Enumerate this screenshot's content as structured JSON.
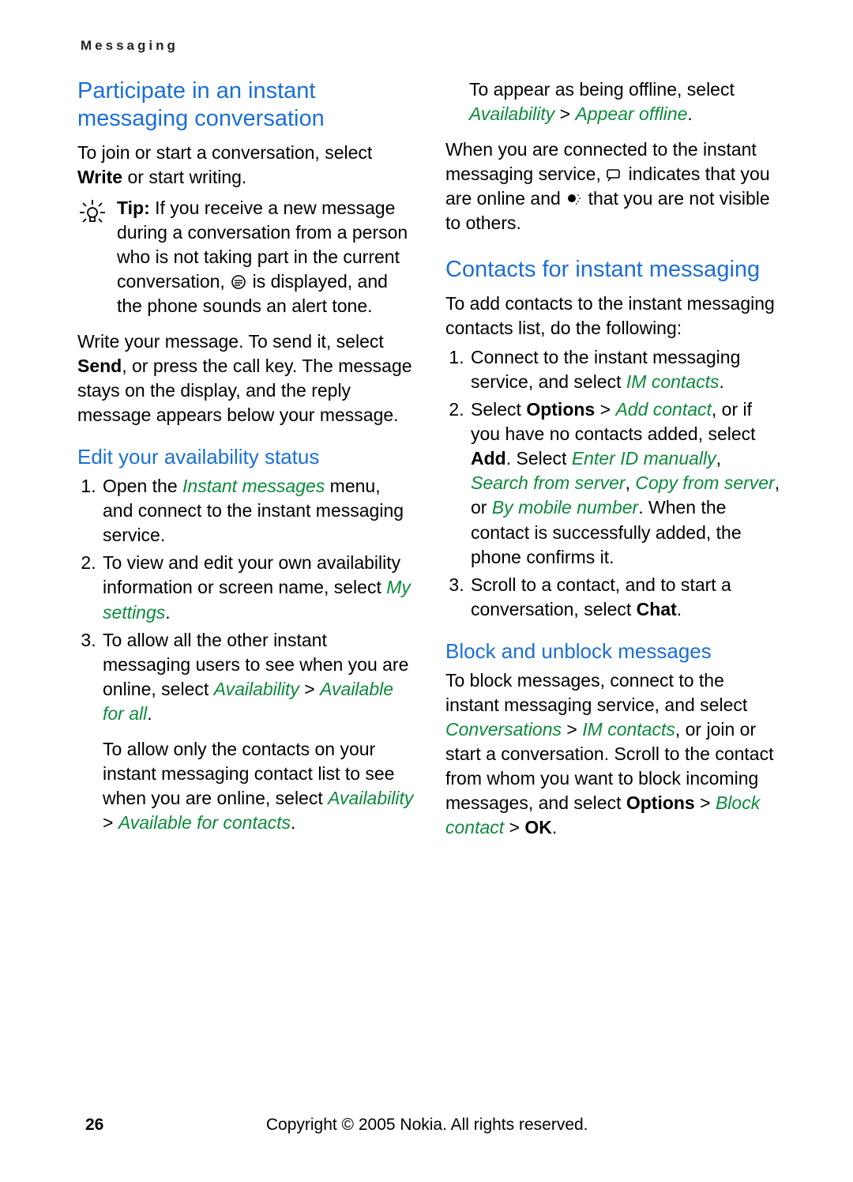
{
  "header": "Messaging",
  "col1": {
    "h2": "Participate in an instant messaging conversation",
    "p1a": "To join or start a conversation, select ",
    "p1b": "Write",
    "p1c": " or start writing.",
    "tipLabel": "Tip: ",
    "tipBody1": "If you receive a new message during a conversation from a person who is not taking part in the current conversation, ",
    "tipBody2": " is displayed, and the phone sounds an alert tone.",
    "p2a": "Write your message. To send it, select ",
    "p2b": "Send",
    "p2c": ", or press the call key. The message stays on the display, and the reply message appears below your message.",
    "h3": "Edit your availability status",
    "li1a": "Open the ",
    "li1b": "Instant messages",
    "li1c": " menu, and connect to the instant messaging service.",
    "li2a": "To view and edit your own availability information or screen name, select ",
    "li2b": "My settings",
    "li2c": ".",
    "li3a": "To allow all the other instant messaging users to see when you are online, select ",
    "li3b": "Availability",
    "li3c": " > ",
    "li3d": "Available for all",
    "li3e": ".",
    "li3pa": "To allow only the contacts on your instant messaging contact list to see when you are online, select ",
    "li3pb": "Availability",
    "li3pc": " > ",
    "li3pd": "Available for contacts",
    "li3pe": "."
  },
  "col2": {
    "offline1": "To appear as being offline, select ",
    "offline2": "Availability",
    "offline3": " > ",
    "offline4": "Appear offline",
    "offline5": ".",
    "conn1": "When you are connected to the instant messaging service, ",
    "conn2": " indicates that you are online and ",
    "conn3": " that you are not visible to others.",
    "h2a": "Contacts for instant messaging",
    "addIntro": "To add contacts to the instant messaging contacts list, do the following:",
    "cli1a": "Connect to the instant messaging service, and select ",
    "cli1b": "IM contacts",
    "cli1c": ".",
    "cli2a": "Select ",
    "cli2b": "Options",
    "cli2c": " > ",
    "cli2d": "Add contact",
    "cli2e": ", or if you have no contacts added, select ",
    "cli2f": "Add",
    "cli2g": ". Select ",
    "cli2h": "Enter ID manually",
    "cli2i": ", ",
    "cli2j": "Search from server",
    "cli2k": ", ",
    "cli2l": "Copy from server",
    "cli2m": ", or ",
    "cli2n": "By mobile number",
    "cli2o": ". When the contact is successfully added, the phone confirms it.",
    "cli3a": "Scroll to a contact, and to start a conversation, select ",
    "cli3b": "Chat",
    "cli3c": ".",
    "h3b": "Block and unblock messages",
    "blk1": "To block messages, connect to the instant messaging service, and select ",
    "blk2": "Conversations",
    "blk3": " > ",
    "blk4": "IM contacts",
    "blk5": ", or join or start a conversation. Scroll to the contact from whom you want to block incoming messages, and select ",
    "blk6": "Options",
    "blk7": " > ",
    "blk8": "Block contact",
    "blk9": " > ",
    "blk10": "OK",
    "blk11": "."
  },
  "footer": {
    "page": "26",
    "copyright": "Copyright © 2005 Nokia. All rights reserved."
  }
}
